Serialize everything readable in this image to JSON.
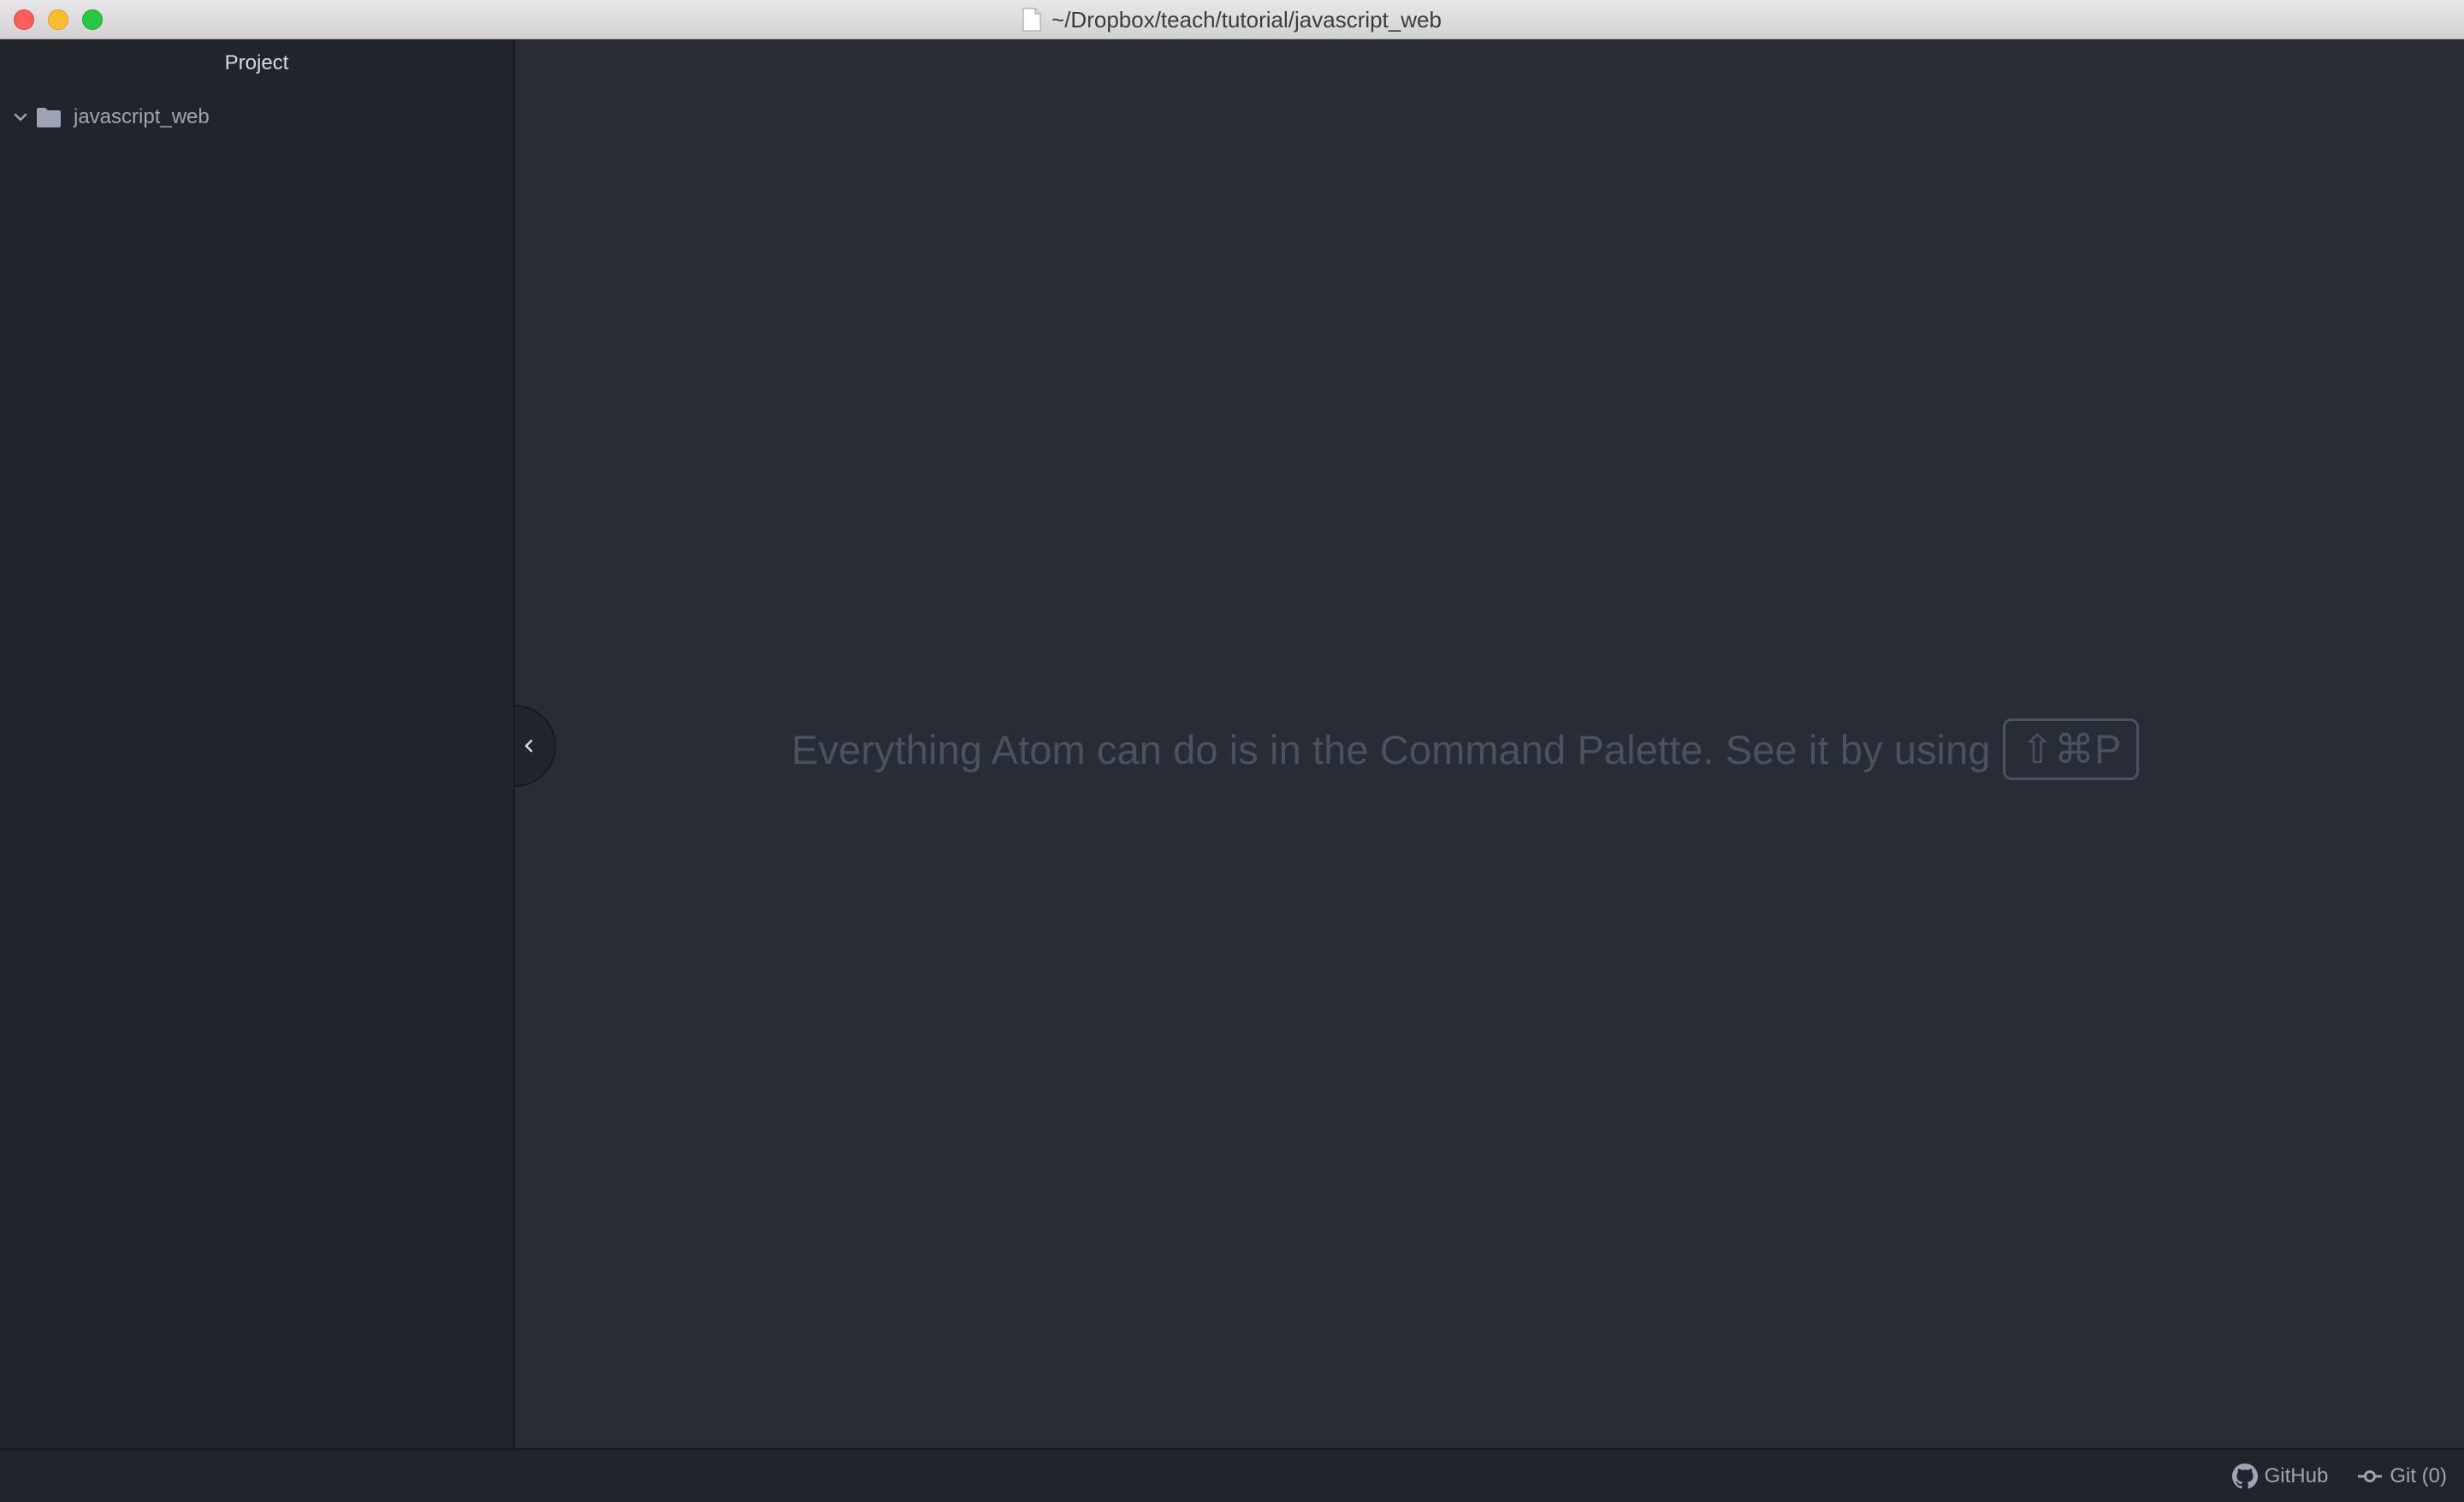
{
  "window": {
    "title": "~/Dropbox/teach/tutorial/javascript_web"
  },
  "sidebar": {
    "dock_tab_label": "Project",
    "tree": {
      "root_label": "javascript_web",
      "expanded": true
    }
  },
  "main": {
    "hint_text": "Everything Atom can do is in the Command Palette. See it by using",
    "shortcut": "⇧⌘P"
  },
  "statusbar": {
    "github_label": "GitHub",
    "git_label": "Git (0)"
  },
  "colors": {
    "background": "#21252b",
    "editor_background": "#282c34",
    "text_muted": "#9da5b4",
    "hint_text": "#4b5160"
  },
  "icons": {
    "tree_chevron": "chevron-down-icon",
    "tree_folder": "folder-icon",
    "collapse_handle": "chevron-left-icon",
    "github": "github-icon",
    "git": "git-commit-icon",
    "title_document": "document-icon"
  }
}
